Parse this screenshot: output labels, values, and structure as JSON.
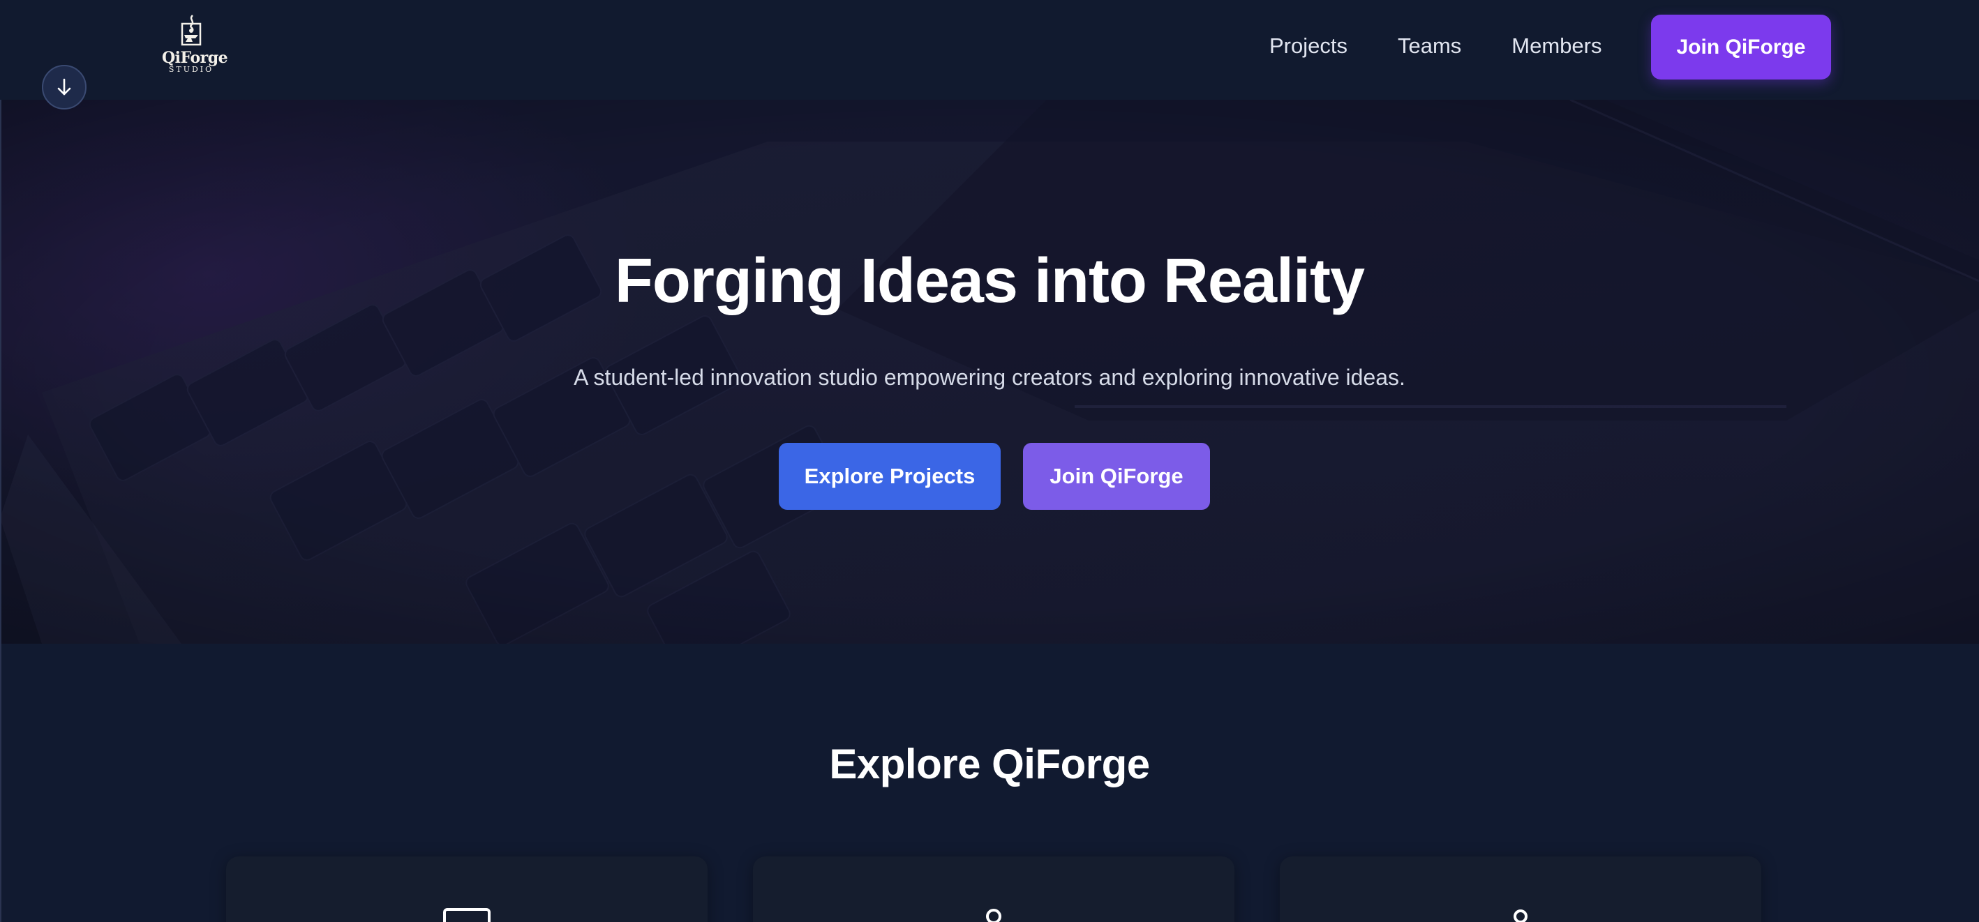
{
  "brand": {
    "name": "QiForge",
    "subtitle": "STUDIO"
  },
  "nav": {
    "links": [
      "Projects",
      "Teams",
      "Members"
    ],
    "cta_label": "Join QiForge"
  },
  "hero": {
    "title": "Forging Ideas into Reality",
    "subtitle": "A student-led innovation studio empowering creators and exploring innovative ideas.",
    "primary_button": "Explore Projects",
    "secondary_button": "Join QiForge"
  },
  "explore": {
    "title": "Explore QiForge",
    "cards": [
      {
        "icon": "laptop-icon"
      },
      {
        "icon": "lightbulb-icon"
      },
      {
        "icon": "users-icon"
      }
    ]
  },
  "colors": {
    "background": "#111a30",
    "nav_cta": "#7c3aed",
    "primary_button": "#3b66e6",
    "secondary_button": "#7c5ce8"
  },
  "icons": {
    "scroll_button": "arrow-down-icon"
  }
}
